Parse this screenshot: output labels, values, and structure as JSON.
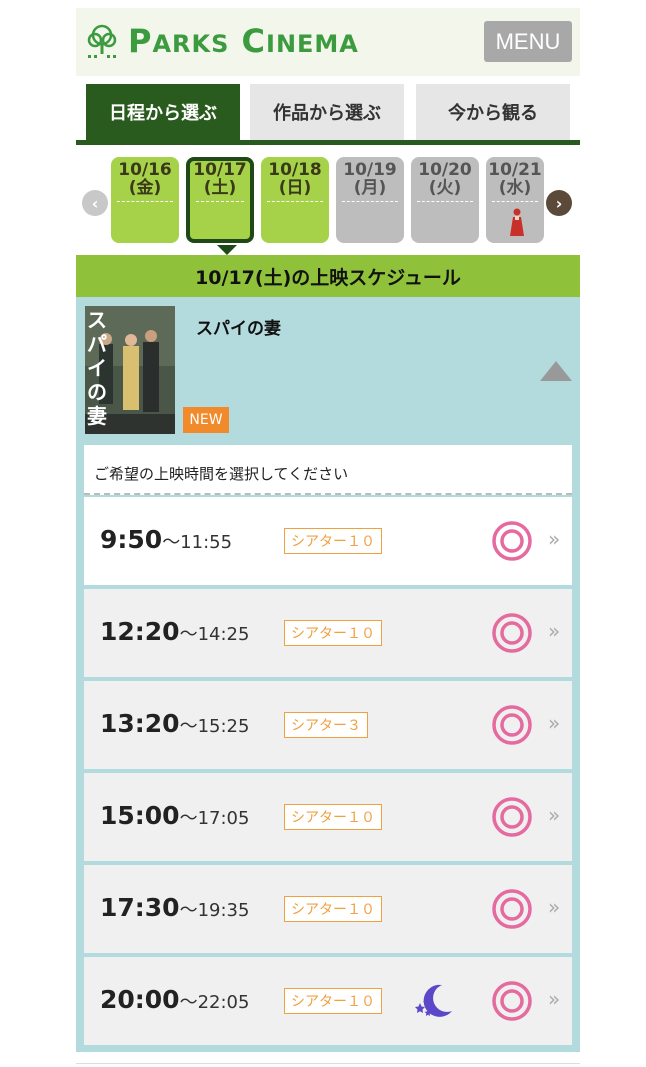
{
  "header": {
    "logo_text_1": "P",
    "logo_text_2": "ARKS",
    "logo_text_3": "C",
    "logo_text_4": "INEMA",
    "menu_label": "MENU"
  },
  "tabs": [
    {
      "label": "日程から選ぶ",
      "active": true
    },
    {
      "label": "作品から選ぶ",
      "active": false
    },
    {
      "label": "今から観る",
      "active": false
    }
  ],
  "dates": [
    {
      "date": "10/16",
      "day": "(金)",
      "state": "available"
    },
    {
      "date": "10/17",
      "day": "(土)",
      "state": "selected"
    },
    {
      "date": "10/18",
      "day": "(日)",
      "state": "available"
    },
    {
      "date": "10/19",
      "day": "(月)",
      "state": "unavailable"
    },
    {
      "date": "10/20",
      "day": "(火)",
      "state": "unavailable"
    },
    {
      "date": "10/21",
      "day": "(水)",
      "state": "unavailable"
    }
  ],
  "schedule_heading": "10/17(土)の上映スケジュール",
  "film": {
    "title": "スパイの妻",
    "badge": "NEW",
    "poster_text": "スパイの妻",
    "select_prompt": "ご希望の上映時間を選択してください"
  },
  "showtimes": [
    {
      "start": "9:50",
      "end": "〜11:55",
      "theater": "シアター１０",
      "availability": "◎",
      "late_show": false
    },
    {
      "start": "12:20",
      "end": "〜14:25",
      "theater": "シアター１０",
      "availability": "◎",
      "late_show": false
    },
    {
      "start": "13:20",
      "end": "〜15:25",
      "theater": "シアター３",
      "availability": "◎",
      "late_show": false
    },
    {
      "start": "15:00",
      "end": "〜17:05",
      "theater": "シアター１０",
      "availability": "◎",
      "late_show": false
    },
    {
      "start": "17:30",
      "end": "〜19:35",
      "theater": "シアター１０",
      "availability": "◎",
      "late_show": false
    },
    {
      "start": "20:00",
      "end": "〜22:05",
      "theater": "シアター１０",
      "availability": "◎",
      "late_show": true
    }
  ],
  "colors": {
    "brand_green": "#3c9a3f",
    "tab_active": "#2a5b1e",
    "date_available": "#a6d24a",
    "date_unavailable": "#bdbdbd",
    "heading_bg": "#8fc23a",
    "film_bg": "#b3dbde",
    "theater_orange": "#f0a040",
    "availability_pink": "#e46aa0",
    "moon_purple": "#5a48c8"
  }
}
